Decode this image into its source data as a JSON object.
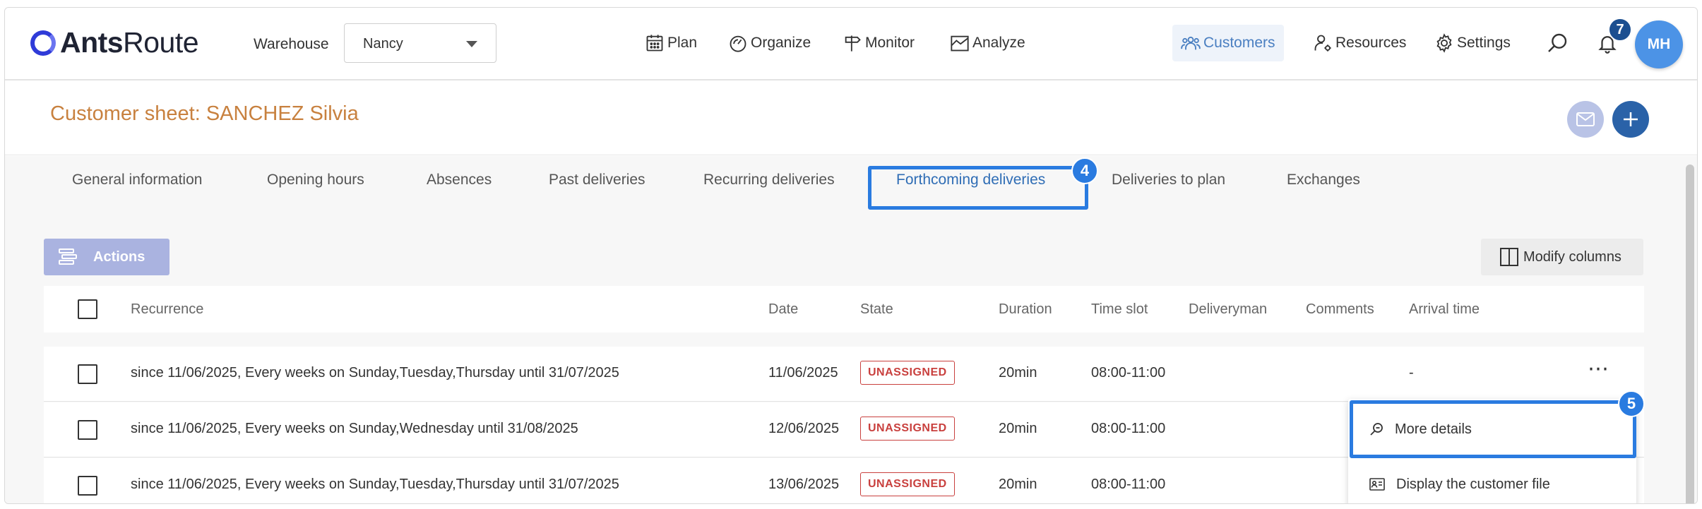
{
  "app": {
    "logo_bold": "Ants",
    "logo_light": "Route"
  },
  "header": {
    "warehouse_label": "Warehouse",
    "warehouse_value": "Nancy",
    "nav": [
      {
        "label": "Plan",
        "icon": "calendar-icon"
      },
      {
        "label": "Organize",
        "icon": "gauge-icon"
      },
      {
        "label": "Monitor",
        "icon": "signpost-icon"
      },
      {
        "label": "Analyze",
        "icon": "chart-icon"
      },
      {
        "label": "Customers",
        "icon": "users-icon",
        "active": true
      },
      {
        "label": "Resources",
        "icon": "user-gear-icon"
      },
      {
        "label": "Settings",
        "icon": "gear-icon"
      }
    ],
    "notifications_count": "7",
    "avatar_initials": "MH"
  },
  "sheet": {
    "title": "Customer sheet: SANCHEZ Silvia"
  },
  "tabs": [
    "General information",
    "Opening hours",
    "Absences",
    "Past deliveries",
    "Recurring deliveries",
    "Forthcoming deliveries",
    "Deliveries to plan",
    "Exchanges"
  ],
  "active_tab": "Forthcoming deliveries",
  "step_badges": {
    "tab": "4",
    "menu": "5"
  },
  "toolbar": {
    "actions_label": "Actions",
    "modify_columns_label": "Modify columns"
  },
  "table": {
    "columns": [
      "Recurrence",
      "Date",
      "State",
      "Duration",
      "Time slot",
      "Deliveryman",
      "Comments",
      "Arrival time"
    ],
    "rows": [
      {
        "recurrence": "since 11/06/2025, Every weeks on Sunday,Tuesday,Thursday until 31/07/2025",
        "date": "11/06/2025",
        "state": "UNASSIGNED",
        "duration": "20min",
        "time_slot": "08:00-11:00",
        "arrival": "-"
      },
      {
        "recurrence": "since 11/06/2025, Every weeks on Sunday,Wednesday until 31/08/2025",
        "date": "12/06/2025",
        "state": "UNASSIGNED",
        "duration": "20min",
        "time_slot": "08:00-11:00",
        "arrival": ""
      },
      {
        "recurrence": "since 11/06/2025, Every weeks on Sunday,Tuesday,Thursday until 31/07/2025",
        "date": "13/06/2025",
        "state": "UNASSIGNED",
        "duration": "20min",
        "time_slot": "08:00-11:00",
        "arrival": ""
      }
    ],
    "row_menu_glyph": "⋯"
  },
  "row_menu": {
    "items": [
      "More details",
      "Display the customer file"
    ]
  },
  "colors": {
    "accent": "#2a7be0",
    "brand_blue": "#2a62a8",
    "title_orange": "#c8813f",
    "unassigned_red": "#c9403e"
  }
}
